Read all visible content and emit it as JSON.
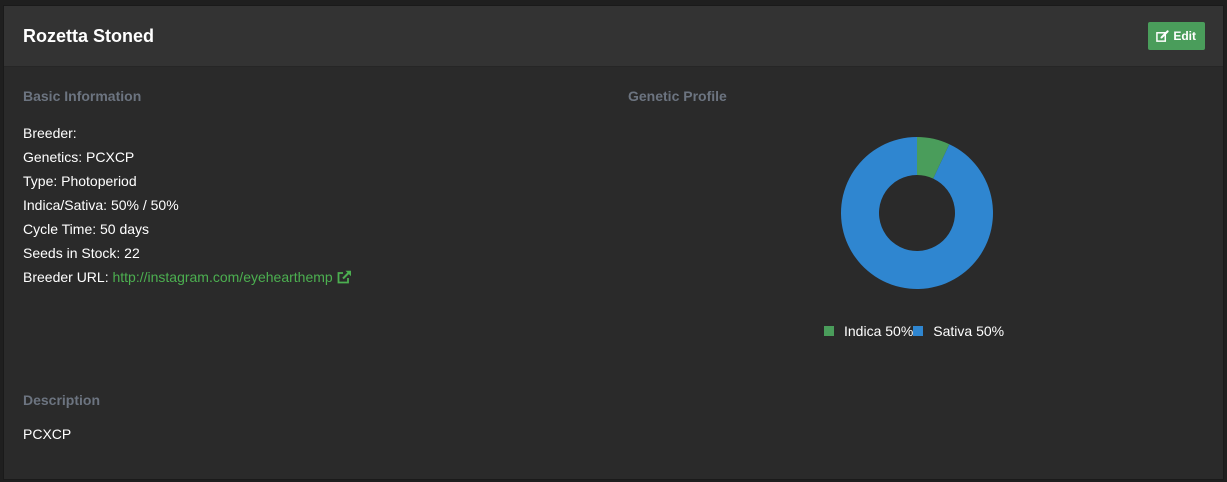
{
  "header": {
    "title": "Rozetta Stoned",
    "edit_label": "Edit"
  },
  "basic_info": {
    "heading": "Basic Information",
    "breeder": "Breeder:",
    "genetics": "Genetics: PCXCP",
    "type": "Type: Photoperiod",
    "ratio": "Indica/Sativa: 50% / 50%",
    "cycle_time": "Cycle Time: 50 days",
    "seeds_in_stock": "Seeds in Stock: 22",
    "breeder_url_label": "Breeder URL: ",
    "breeder_url": "http://instagram.com/eyehearthemp"
  },
  "genetic_profile": {
    "heading": "Genetic Profile"
  },
  "description": {
    "heading": "Description",
    "text": "PCXCP"
  },
  "colors": {
    "accent_green": "#4caf50",
    "edit_button": "#4a9d5b",
    "indica": "#4a9d5b",
    "sativa": "#2f86d0"
  },
  "icons": {
    "edit": "edit-icon",
    "external_link": "external-link-icon"
  },
  "chart_data": {
    "type": "pie",
    "categories": [
      "Indica 50%",
      "Sativa 50%"
    ],
    "values": [
      7,
      93
    ],
    "colors": [
      "#4a9d5b",
      "#2f86d0"
    ],
    "legend": "bottom"
  }
}
